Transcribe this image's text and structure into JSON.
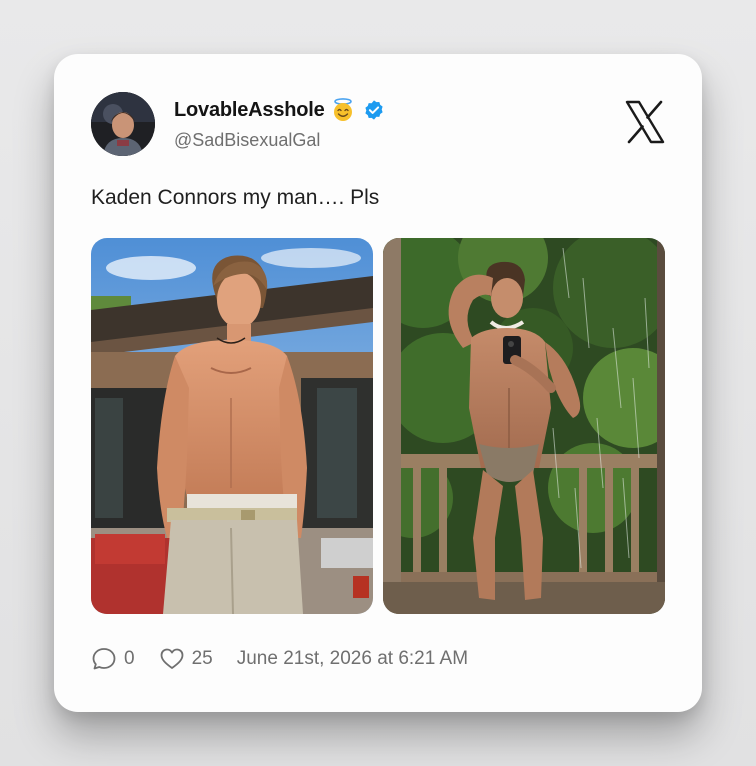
{
  "author": {
    "display_name": "LovableAsshole",
    "handle": "@SadBisexualGal",
    "name_emoji": "smiling-face-with-halo-emoji",
    "verified": true,
    "verified_color": "#1d9bf0"
  },
  "brand": {
    "logo": "x-logo-icon"
  },
  "tweet": {
    "text": "Kaden Connors my man…. Pls",
    "photos": [
      {
        "subject": "shirtless man in khaki shorts standing outdoors in front of a wooden house"
      },
      {
        "subject": "man in swim briefs taking a mirror selfie on a wooden deck surrounded by trees"
      }
    ]
  },
  "stats": {
    "replies": "0",
    "likes": "25",
    "timestamp": "June 21st, 2026 at 6:21 AM"
  },
  "colors": {
    "background": "#e5e5e6",
    "card": "#fdfdfd",
    "text": "#1f1f1f",
    "muted": "#6f6f6f"
  }
}
